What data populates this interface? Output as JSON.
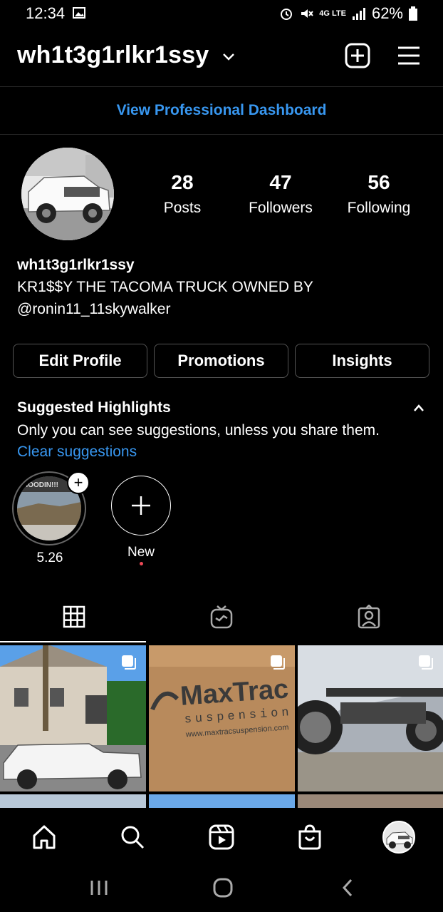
{
  "status_bar": {
    "time": "12:34",
    "battery": "62%",
    "network": "4G LTE"
  },
  "header": {
    "username": "wh1t3g1rlkr1ssy",
    "icons": [
      "chevron-down-icon",
      "new-post-icon",
      "menu-icon"
    ]
  },
  "dashboard": {
    "label": "View Professional Dashboard"
  },
  "profile": {
    "stats": [
      {
        "value": "28",
        "label": "Posts"
      },
      {
        "value": "47",
        "label": "Followers"
      },
      {
        "value": "56",
        "label": "Following"
      }
    ],
    "name": "wh1t3g1rlkr1ssy",
    "bio_line1": "KR1$$Y THE TACOMA TRUCK OWNED BY",
    "bio_line2": "@ronin11_11skywalker"
  },
  "buttons": {
    "edit_profile": "Edit Profile",
    "promotions": "Promotions",
    "insights": "Insights"
  },
  "highlights": {
    "title": "Suggested Highlights",
    "description": "Only you can see suggestions, unless you share them.",
    "clear": "Clear suggestions",
    "items": [
      {
        "label": "5.26",
        "cover_text": "HOODIN!!!"
      },
      {
        "label": "New"
      }
    ]
  },
  "tabs": [
    "grid-icon",
    "igtv-icon",
    "tagged-icon"
  ],
  "grid_posts": [
    {
      "description": "white Tacoma truck in front of house"
    },
    {
      "description": "MaxTrac suspension box",
      "text1": "MaxTrac",
      "text2": "suspension",
      "text3": "www.maxtracsuspension.com"
    },
    {
      "description": "truck wheel closeup"
    }
  ],
  "bottom_nav": [
    "home-icon",
    "search-icon",
    "reels-icon",
    "shop-icon",
    "profile-avatar"
  ],
  "colors": {
    "background": "#000000",
    "link": "#3897f0",
    "text": "#ffffff",
    "divider": "#262626"
  }
}
